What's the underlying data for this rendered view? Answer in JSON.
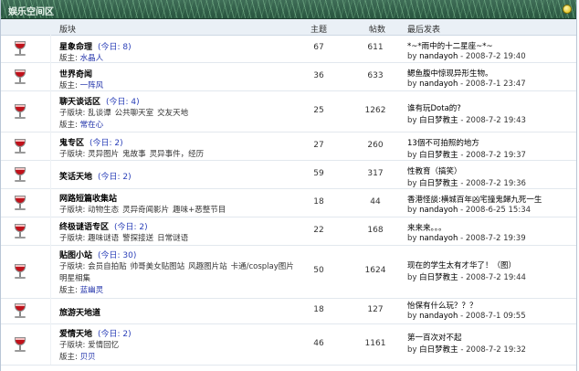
{
  "category": {
    "title": "娱乐空间区"
  },
  "columns": {
    "forum": "版块",
    "topics": "主题",
    "posts": "帖数",
    "last": "最后发表"
  },
  "forums": [
    {
      "name": "星象命理",
      "today": "(今日: 8)",
      "subforums_label": "",
      "subforums": [],
      "moderator_label": "版主:",
      "moderator": "水晶人",
      "topics": "67",
      "posts": "611",
      "last_title": "*~*雨中的十二星座~*~",
      "last_by_prefix": "by",
      "last_user": "nandayoh",
      "last_time": "- 2008-7-2 19:40"
    },
    {
      "name": "世界奇闻",
      "today": "",
      "subforums_label": "",
      "subforums": [],
      "moderator_label": "版主:",
      "moderator": "一阵风",
      "topics": "36",
      "posts": "633",
      "last_title": "鳃鱼腹中惊现异形生物。",
      "last_by_prefix": "by",
      "last_user": "nandayoh",
      "last_time": "- 2008-7-1 23:47"
    },
    {
      "name": "聊天谈话区",
      "today": "(今日: 4)",
      "subforums_label": "子版块:",
      "subforums": [
        "乱谈谭",
        "公共聊天室",
        "交友天地"
      ],
      "moderator_label": "版主:",
      "moderator": "常在心",
      "topics": "25",
      "posts": "1262",
      "last_title": "谁有玩Dota的?",
      "last_by_prefix": "by",
      "last_user": "白日梦教主",
      "last_time": "- 2008-7-2 19:43"
    },
    {
      "name": "鬼专区",
      "today": "(今日: 2)",
      "subforums_label": "子版块:",
      "subforums": [
        "灵异图片",
        "鬼故事",
        "灵异事件，经历"
      ],
      "moderator_label": "",
      "moderator": "",
      "topics": "27",
      "posts": "260",
      "last_title": "13個不可拍照的地方",
      "last_by_prefix": "by",
      "last_user": "白日梦教主",
      "last_time": "- 2008-7-2 19:37"
    },
    {
      "name": "笑话天地",
      "today": "(今日: 2)",
      "subforums_label": "",
      "subforums": [],
      "moderator_label": "",
      "moderator": "",
      "topics": "59",
      "posts": "317",
      "last_title": "性教育（搞笑）",
      "last_by_prefix": "by",
      "last_user": "白日梦教主",
      "last_time": "- 2008-7-2 19:36"
    },
    {
      "name": "网路短篇收集站",
      "today": "",
      "subforums_label": "子版块:",
      "subforums": [
        "动物生态",
        "灵异奇闻影片",
        "趣味+恶整节目"
      ],
      "moderator_label": "",
      "moderator": "",
      "topics": "18",
      "posts": "44",
      "last_title": "香港怪談:横城百年凶宅撞鬼歸九死一生",
      "last_by_prefix": "by",
      "last_user": "nandayoh",
      "last_time": "- 2008-6-25 15:34"
    },
    {
      "name": "终极谜语专区",
      "today": "(今日: 2)",
      "subforums_label": "子版块:",
      "subforums": [
        "趣味谜语",
        "警探接送",
        "日常谜语"
      ],
      "moderator_label": "",
      "moderator": "",
      "topics": "22",
      "posts": "168",
      "last_title": "来来来。。。",
      "last_by_prefix": "by",
      "last_user": "nandayoh",
      "last_time": "- 2008-7-2 19:39"
    },
    {
      "name": "贴图小站",
      "today": "(今日: 30)",
      "subforums_label": "子版块:",
      "subforums": [
        "会员自拍贴",
        "帅哥美女贴图站",
        "风趣图片站",
        "卡通/cosplay图片",
        "明星相集"
      ],
      "moderator_label": "版主:",
      "moderator": "蓝幽灵",
      "topics": "50",
      "posts": "1624",
      "last_title": "现在的学生太有才华了！（图）",
      "last_by_prefix": "by",
      "last_user": "白日梦教主",
      "last_time": "- 2008-7-2 19:44"
    },
    {
      "name": "旅游天地道",
      "today": "",
      "subforums_label": "",
      "subforums": [],
      "moderator_label": "",
      "moderator": "",
      "topics": "18",
      "posts": "127",
      "last_title": "怡保有什么玩？？？",
      "last_by_prefix": "by",
      "last_user": "nandayoh",
      "last_time": "- 2008-7-1 09:55"
    },
    {
      "name": "爱情天地",
      "today": "(今日: 2)",
      "subforums_label": "子版块:",
      "subforums": [
        "爱情回忆"
      ],
      "moderator_label": "版主:",
      "moderator": "贝贝",
      "topics": "46",
      "posts": "1161",
      "last_title": "第一百次对不起",
      "last_by_prefix": "by",
      "last_user": "白日梦教主",
      "last_time": "- 2008-7-2 19:32"
    }
  ]
}
